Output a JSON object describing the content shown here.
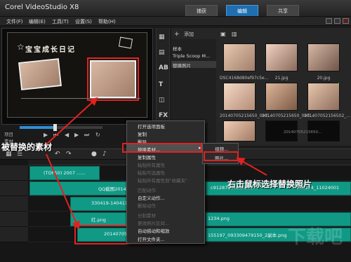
{
  "app": {
    "title": "Corel VideoStudio X8",
    "tabs": [
      "捕获",
      "编辑",
      "共享"
    ]
  },
  "menu": {
    "items": [
      "文件(F)",
      "编辑(E)",
      "工具(T)",
      "设置(S)",
      "帮助(H)"
    ]
  },
  "preview": {
    "board_title": "宝宝成长日记",
    "project_label": "项目",
    "clip_label": "素材"
  },
  "library": {
    "list": [
      "样本",
      "Triple Scoop M...",
      "替换照片"
    ],
    "thumbs": [
      "DSC4168d80ef97c5e...",
      "21.jpg",
      "20.jpg",
      "20140705215650_09d...",
      "20140705215650_09d...",
      "201407052156502_...",
      "20140705215650...",
      "",
      "",
      ""
    ]
  },
  "context_menu": {
    "items": [
      "打开选项面板",
      "复制",
      "删除",
      "替换素材...",
      "复制属性",
      "粘贴所有属性",
      "粘贴可选属性",
      "粘贴所有属性到\"收藏夹\"",
      "匹配动作",
      "自定义动作...",
      "删除动作",
      "分割素材",
      "更改照片区间...",
      "自动摇动和缩放",
      "打开文件夹..."
    ],
    "submenu": [
      "视频...",
      "照片..."
    ]
  },
  "timeline": {
    "clips": [
      "(TOP50) 2007 ......",
      "QQ截图20140...",
      "c9128763e0acd55...",
      "145234_11024001",
      "330419-14041109",
      "红.png",
      "2014070521565...",
      "1234.png",
      "155197_093309479150_2副本.png"
    ]
  },
  "callouts": {
    "left": "被替换的素材",
    "right": "右击鼠标选择替换照片"
  },
  "watermark": "下载吧"
}
